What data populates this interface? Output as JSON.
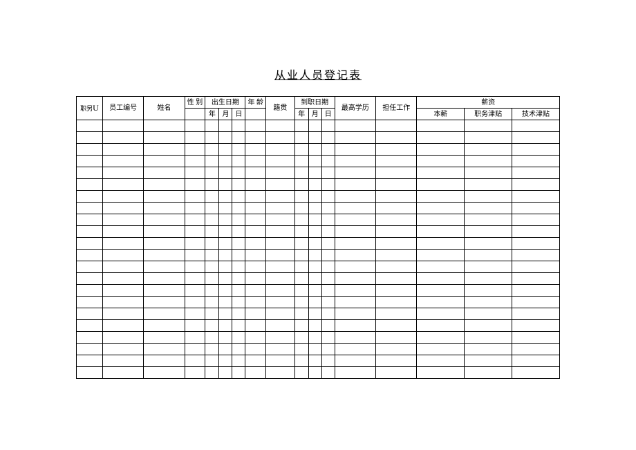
{
  "title": "从业人员登记表",
  "headers": {
    "jibie_prefix": "职另",
    "jibie_u": "U",
    "empno": "员工编号",
    "name": "姓名",
    "gender": "性 别",
    "birthdate": "出生日期",
    "age": "年 龄",
    "jiguan": "籍贯",
    "hiredate": "到职日期",
    "education": "最高学历",
    "jobduty": "担任工作",
    "salary": "薪资",
    "year": "年",
    "month": "月",
    "day": "日",
    "salary_base": "本薪",
    "salary_duty": "职务津贴",
    "salary_tech": "技术津贴"
  },
  "data_row_count": 22
}
